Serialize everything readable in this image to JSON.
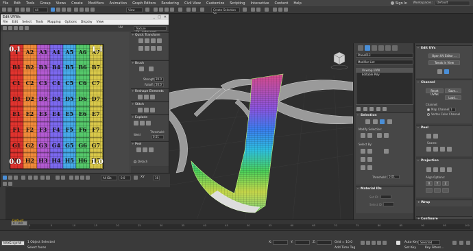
{
  "menubar": {
    "items": [
      "File",
      "Edit",
      "Tools",
      "Group",
      "Views",
      "Create",
      "Modifiers",
      "Animation",
      "Graph Editors",
      "Rendering",
      "Civil View",
      "Customize",
      "Scripting",
      "Interactive",
      "Content",
      "Help"
    ],
    "signin": "Sign In",
    "workspaces_label": "Workspaces:",
    "workspaces_value": "Default"
  },
  "toolbar": {
    "view_combo": "View",
    "selection_set": "Create Selection Se"
  },
  "uv_window": {
    "title": "Edit UVWs",
    "menu": [
      "File",
      "Edit",
      "Select",
      "Tools",
      "Mapping",
      "Options",
      "Display",
      "View"
    ],
    "uv_label": "UV",
    "texture_combo": "Texture Ch...ecker.png)",
    "grid_rows": [
      [
        "1",
        "A2",
        "A3",
        "A4",
        "A5",
        "A6",
        "A7"
      ],
      [
        "B1",
        "B2",
        "B3",
        "B4",
        "B5",
        "B6",
        "B7"
      ],
      [
        "C1",
        "C2",
        "C3",
        "C4",
        "C5",
        "C6",
        "C7"
      ],
      [
        "D1",
        "D2",
        "D3",
        "D4",
        "D5",
        "D6",
        "D7"
      ],
      [
        "E1",
        "E2",
        "E3",
        "E4",
        "E5",
        "E6",
        "E7"
      ],
      [
        "F1",
        "F2",
        "F3",
        "F4",
        "F5",
        "F6",
        "F7"
      ],
      [
        "G1",
        "G2",
        "G3",
        "G4",
        "G5",
        "G6",
        "G7"
      ],
      [
        "H1",
        "H2",
        "H3",
        "H4",
        "H5",
        "H6",
        "H7"
      ]
    ],
    "corner_labels": {
      "tl": "0.1",
      "tr": "1.1",
      "bl": "0.0",
      "br": "1.0"
    },
    "column_colors": [
      "#e0332e",
      "#f08a3a",
      "#b25ad0",
      "#7b68ee",
      "#47a9e8",
      "#55c76a",
      "#d8c84a"
    ],
    "side": {
      "quick_transform": "Quick Transform",
      "brush": "Brush",
      "strength_label": "Strength:",
      "strength_value": "20.0",
      "falloff_label": "Falloff:",
      "falloff_value": "20.0",
      "reshape": "Reshape Elements",
      "stitch": "Stitch",
      "explode": "Explode",
      "weld": "Weld",
      "threshold_label": "Threshold:",
      "threshold_value": "0.01",
      "peel": "Peel",
      "detach": "Detach"
    },
    "bottom": {
      "xy": "XY",
      "ids": "All IDs",
      "value": "0.0",
      "num": "16"
    }
  },
  "command_panel": {
    "object_name": "Plane013",
    "modifier_list": "Modifier List",
    "stack": [
      "Unwrap UVW",
      "Editable Poly"
    ],
    "selection": "Selection",
    "modify_selection": "Modify Selection:",
    "select_by": "Select By:",
    "threshold_label": "Threshold:",
    "threshold_value": "0.01",
    "material_ids": "Material IDs",
    "set_id": "Set ID:",
    "select_id": "Select ID"
  },
  "right_panel": {
    "edit_uvs": "Edit UVs",
    "open_uv_editor": "Open UV Editor ...",
    "tweak_in_view": "Tweak In View",
    "channel": "Channel",
    "reset_uvws": "Reset UVWs",
    "save": "Save...",
    "load": "Load...",
    "channel_label": "Channel:",
    "map_channel": "Map Channel:",
    "map_channel_value": "1",
    "vertex_color": "Vertex Color Channel",
    "peel": "Peel",
    "seams": "Seams:",
    "projection": "Projection",
    "align_options": "Align Options:",
    "wrap": "Wrap",
    "configure": "Configure"
  },
  "timeline": {
    "frame": "0 / 100",
    "ticks": [
      "0",
      "5",
      "10",
      "15",
      "20",
      "25",
      "30",
      "35",
      "40",
      "45",
      "50",
      "55",
      "60",
      "65",
      "70",
      "75",
      "80",
      "85",
      "90",
      "95",
      "100"
    ],
    "layer": "Default"
  },
  "status": {
    "maxscript": "MAXScript Mi",
    "objects_selected": "1 Object Selected",
    "select_faces": "Select faces",
    "x_label": "X:",
    "y_label": "Y:",
    "z_label": "Z:",
    "grid": "Grid = 10.0",
    "add_time_tag": "Add Time Tag",
    "auto_key": "Auto Key",
    "selected": "Selected",
    "set_key": "Set Key",
    "key_filters": "Key Filters..."
  }
}
